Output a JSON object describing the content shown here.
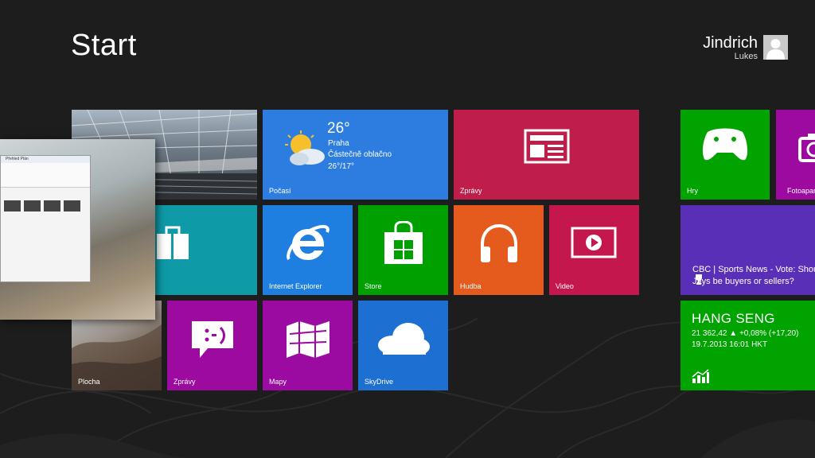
{
  "start_title": "Start",
  "user": {
    "first_name": "Jindrich",
    "last_name": "Lukes"
  },
  "colors": {
    "background": "#1d1d1d",
    "weather": "#2d7de1",
    "news": "#bf1e4b",
    "games": "#00a300",
    "camera": "#9c0aa0",
    "store": "#00a000",
    "music": "#e45b1d",
    "video": "#c4174e",
    "maps": "#9b0aa1",
    "ie": "#1f7fe0",
    "messaging": "#9c0aa0",
    "skydrive": "#1d6fd1",
    "sports": "#5a2fb8",
    "finance": "#00a300",
    "teal": "#0e9aa7"
  },
  "tiles": {
    "weather": {
      "label": "Počasí",
      "temperature": "26°",
      "city": "Praha",
      "description": "Částečně oblačno",
      "range": "26°/17°",
      "icon": "partly-cloudy-icon"
    },
    "news": {
      "label": "Zprávy",
      "icon": "newspaper-icon"
    },
    "games": {
      "label": "Hry",
      "icon": "xbox-controller-icon"
    },
    "camera": {
      "label": "Fotoaparát",
      "icon": "camera-icon"
    },
    "ie": {
      "label": "Internet Explorer",
      "icon": "internet-explorer-icon"
    },
    "store": {
      "label": "Store",
      "icon": "store-bag-icon"
    },
    "music": {
      "label": "Hudba",
      "icon": "headphones-icon"
    },
    "video": {
      "label": "Video",
      "icon": "play-icon"
    },
    "sports": {
      "text": "CBC | Sports News - Vote: Should Jays be buyers or sellers?",
      "icon": "trophy-icon"
    },
    "messaging": {
      "label": "Zprávy",
      "icon": "chat-bubble-icon"
    },
    "maps": {
      "label": "Mapy",
      "icon": "map-icon"
    },
    "skydrive": {
      "label": "SkyDrive",
      "icon": "cloud-icon"
    },
    "finance": {
      "title": "HANG SENG",
      "value_line": "21 362,42  ▲ +0,08% (+17,20)",
      "timestamp": "19.7.2013 16:01 HKT",
      "icon": "stock-chart-icon"
    },
    "desktop": {
      "label": "Plocha"
    },
    "photos": {
      "label": "",
      "icon": "photos-icon"
    }
  },
  "switcher_thumb": {
    "window_title": "Přehled Plán"
  }
}
